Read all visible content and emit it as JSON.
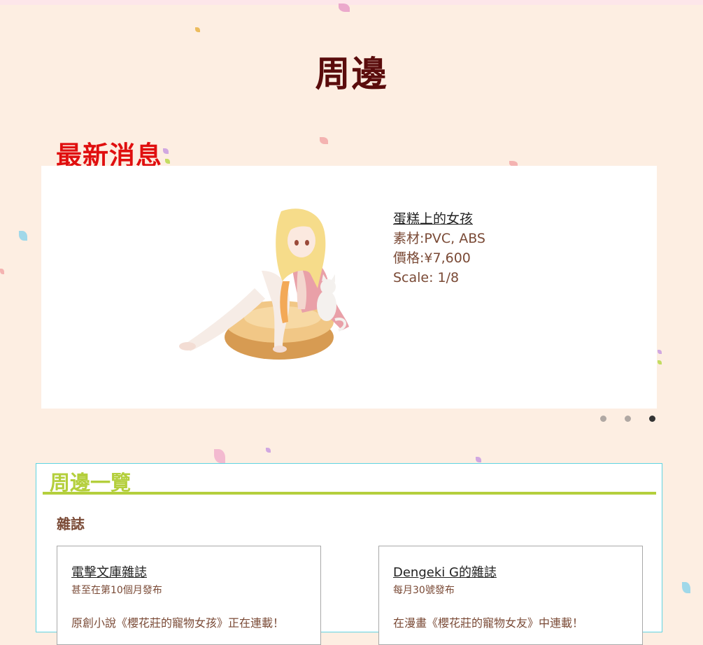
{
  "page": {
    "title": "周邊"
  },
  "news": {
    "heading": "最新消息",
    "slide": {
      "name": "蛋糕上的女孩",
      "material": "素材:PVC, ABS",
      "price": "價格:¥7,600",
      "scale": "Scale: 1/8"
    },
    "carousel": {
      "count": 3,
      "active_index": 2
    }
  },
  "catalog": {
    "heading": "周邊一覽",
    "section": "雜誌",
    "cards": [
      {
        "title": "電擊文庫雜誌",
        "subtitle": "甚至在第10個月發布",
        "desc": "原創小說《櫻花莊的寵物女孩》正在連載！"
      },
      {
        "title": "Dengeki G的雜誌",
        "subtitle": "每月30號發布",
        "desc": "在漫畫《櫻花莊的寵物女友》中連載！"
      }
    ]
  },
  "colors": {
    "background": "#fdeee2",
    "page_title": "#5a0c0c",
    "news_heading": "#e00f0f",
    "catalog_heading": "#b4cf3c",
    "catalog_border": "#5fd4e2",
    "body_text": "#7a4a36"
  }
}
